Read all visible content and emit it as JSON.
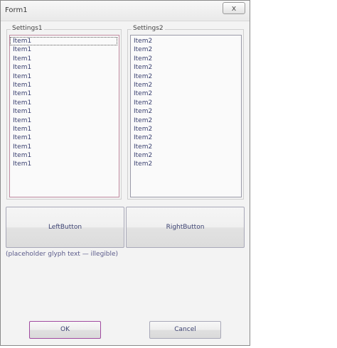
{
  "window": {
    "title": "Form1",
    "close_glyph": "x"
  },
  "settings1": {
    "legend": "Settings1",
    "items": [
      "Item1",
      "Item1",
      "Item1",
      "Item1",
      "Item1",
      "Item1",
      "Item1",
      "Item1",
      "Item1",
      "Item1",
      "Item1",
      "Item1",
      "Item1",
      "Item1",
      "Item1"
    ]
  },
  "settings2": {
    "legend": "Settings2",
    "items": [
      "Item2",
      "Item2",
      "Item2",
      "Item2",
      "Item2",
      "Item2",
      "Item2",
      "Item2",
      "Item2",
      "Item2",
      "Item2",
      "Item2",
      "Item2",
      "Item2",
      "Item2"
    ]
  },
  "buttons": {
    "left": "LeftButton",
    "right": "RightButton",
    "ok": "OK",
    "cancel": "Cancel"
  },
  "description": "(placeholder glyph text — illegible)"
}
